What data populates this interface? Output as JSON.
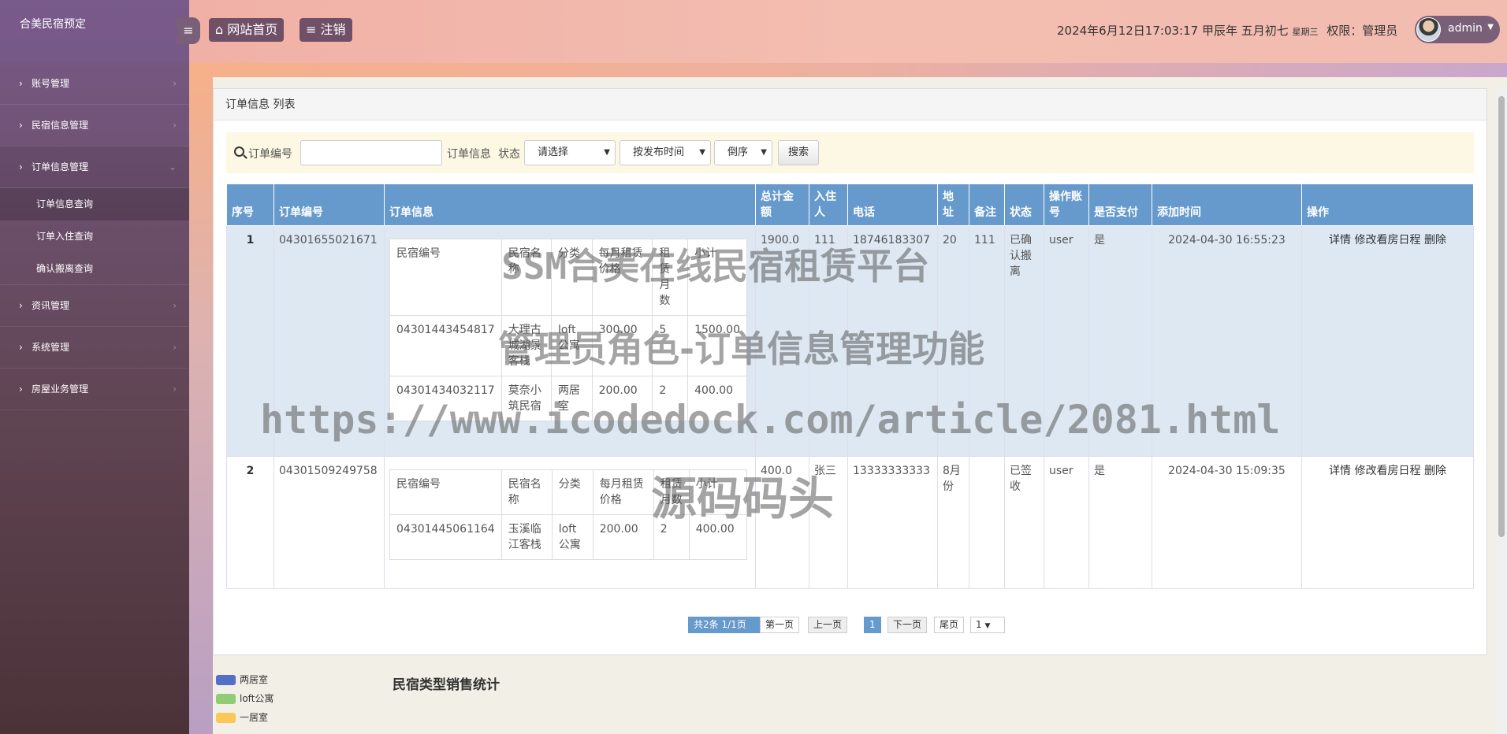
{
  "sidebar": {
    "brand": "合美民宿预定",
    "menu": [
      {
        "label": "账号管理"
      },
      {
        "label": "民宿信息管理"
      },
      {
        "label": "订单信息管理"
      },
      {
        "label": "资讯管理"
      },
      {
        "label": "系统管理"
      },
      {
        "label": "房屋业务管理"
      }
    ],
    "submenu": [
      "订单信息查询",
      "订单入住查询",
      "确认搬离查询"
    ]
  },
  "topbar": {
    "home_label": "网站首页",
    "logout_label": "注销",
    "datetime": "2024年6月12日17:03:17 甲辰年 五月初七",
    "weekday": "星期三",
    "role": "权限：管理员",
    "username": "admin"
  },
  "panel": {
    "title": "订单信息 列表"
  },
  "search": {
    "label_order_no": "订单编号",
    "label_order_info": "订单信息",
    "label_status": "状态",
    "status_value": "请选择",
    "sort_value": "按发布时间",
    "order_value": "倒序",
    "button": "搜索"
  },
  "table": {
    "headers": [
      "序号",
      "订单编号",
      "订单信息",
      "总计金额",
      "入住人",
      "电话",
      "地址",
      "备注",
      "状态",
      "操作账号",
      "是否支付",
      "添加时间",
      "操作"
    ],
    "inner_headers": [
      "民宿编号",
      "民宿名称",
      "分类",
      "每月租赁价格",
      "租赁月数",
      "小计"
    ],
    "rows": [
      {
        "idx": "1",
        "order_no": "04301655021671",
        "items": [
          [
            "04301443454817",
            "大理古城湖景客栈",
            "loft公寓",
            "300.00",
            "5",
            "1500.00"
          ],
          [
            "04301434032117",
            "莫奈小筑民宿",
            "两居室",
            "200.00",
            "2",
            "400.00"
          ]
        ],
        "total": "1900.0",
        "guest": "111",
        "phone": "18746183307",
        "address": "20",
        "remark": "111",
        "status": "已确认搬离",
        "operator": "user",
        "paid": "是",
        "time": "2024-04-30 16:55:23"
      },
      {
        "idx": "2",
        "order_no": "04301509249758",
        "items": [
          [
            "04301445061164",
            "玉溪临江客栈",
            "loft公寓",
            "200.00",
            "2",
            "400.00"
          ]
        ],
        "total": "400.0",
        "guest": "张三",
        "phone": "13333333333",
        "address": "8月份",
        "remark": "",
        "status": "已签收",
        "operator": "user",
        "paid": "是",
        "time": "2024-04-30 15:09:35"
      }
    ],
    "ops": [
      "详情",
      "修改看房日程",
      "删除"
    ]
  },
  "pager": {
    "info": "共2条   1/1页",
    "first": "第一页",
    "prev": "上一页",
    "current": "1",
    "next": "下一页",
    "last": "尾页",
    "select": "1"
  },
  "stats": {
    "title": "民宿类型销售统计",
    "legend": [
      {
        "name": "两居室",
        "color": "#5470c6"
      },
      {
        "name": "loft公寓",
        "color": "#91cc75"
      },
      {
        "name": "一居室",
        "color": "#fac858"
      }
    ]
  },
  "watermark": {
    "line1": "SSM合美在线民宿租赁平台",
    "line2": "管理员角色-订单信息管理功能",
    "line3": "https://www.icodedock.com/article/2081.html",
    "line4": "源码码头"
  }
}
